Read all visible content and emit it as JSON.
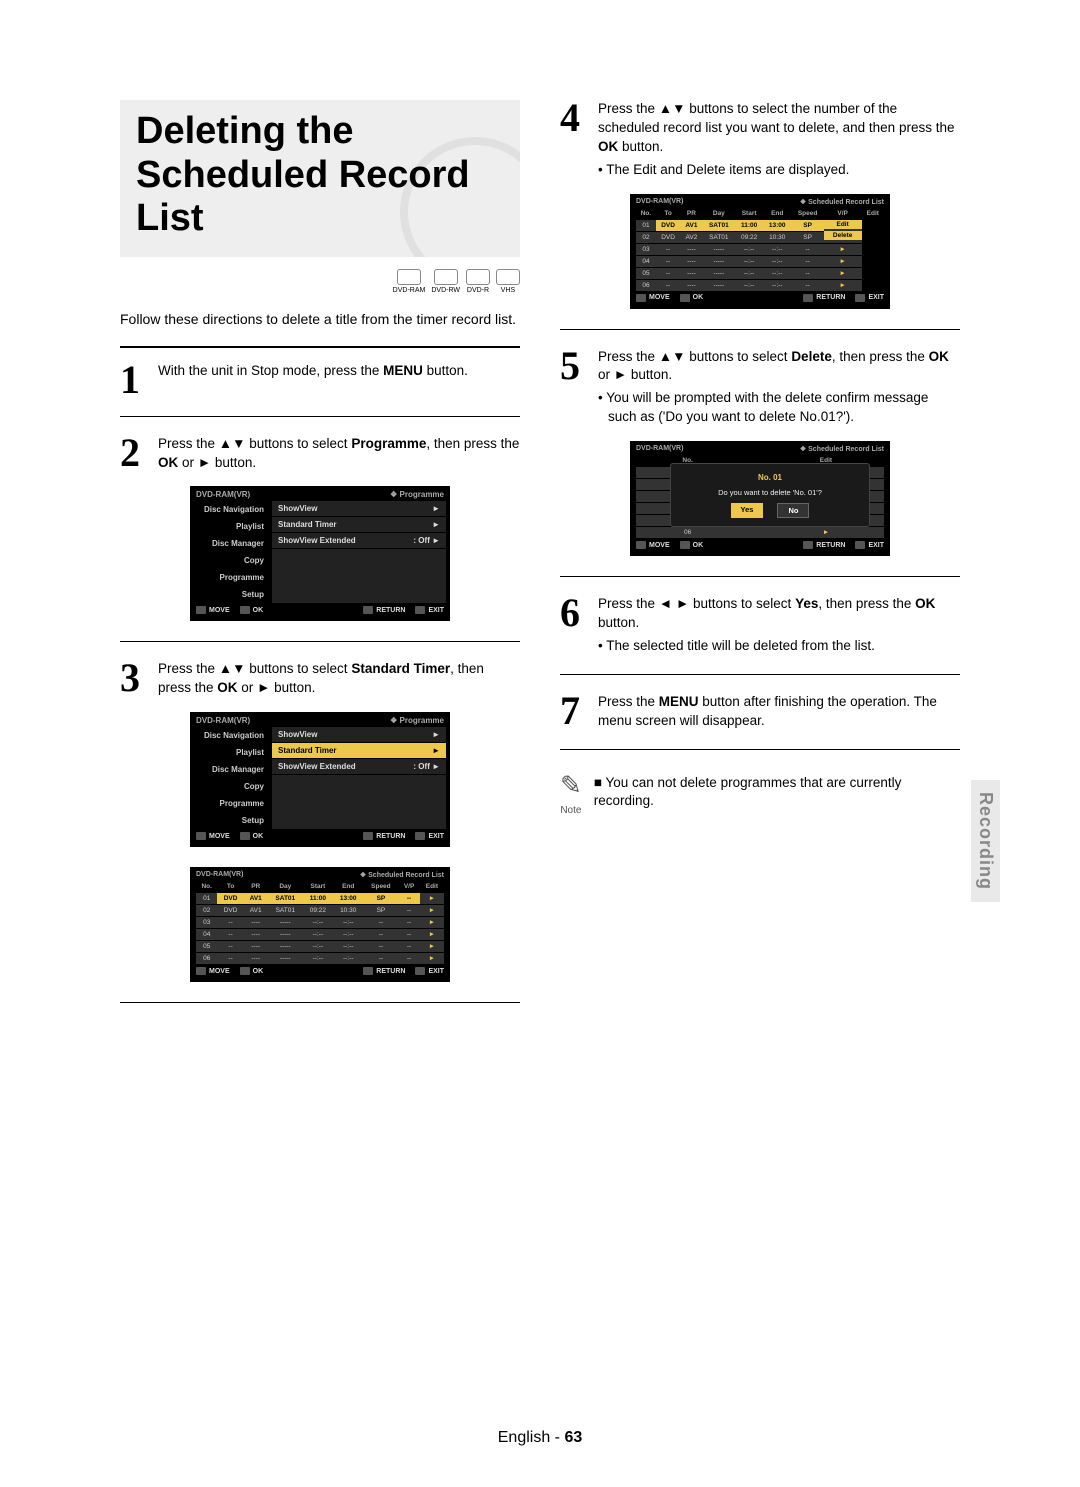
{
  "title": "Deleting the Scheduled Record List",
  "media_badges": [
    "DVD-RAM",
    "DVD-RW",
    "DVD-R",
    "VHS"
  ],
  "intro": "Follow these directions to delete a title from the timer record list.",
  "side_tab": "Recording",
  "footer": {
    "lang": "English",
    "sep": " - ",
    "page": "63"
  },
  "osd_common": {
    "device": "DVD-RAM(VR)",
    "bottom_move": "MOVE",
    "bottom_ok": "OK",
    "bottom_return": "RETURN",
    "bottom_exit": "EXIT"
  },
  "programme_menu": {
    "crumb": "Programme",
    "left": [
      "Disc Navigation",
      "Playlist",
      "Disc Manager",
      "Copy",
      "Programme",
      "Setup"
    ],
    "rows": [
      {
        "label": "ShowView",
        "val": "",
        "sel": false,
        "arrow": "►"
      },
      {
        "label": "Standard Timer",
        "val": "",
        "sel": false,
        "arrow": "►"
      },
      {
        "label": "ShowView Extended",
        "val": ": Off",
        "sel": false,
        "arrow": "►"
      }
    ]
  },
  "programme_menu_sel": {
    "crumb": "Programme",
    "rows": [
      {
        "label": "ShowView",
        "val": "",
        "sel": false,
        "arrow": "►"
      },
      {
        "label": "Standard Timer",
        "val": "",
        "sel": true,
        "arrow": "►"
      },
      {
        "label": "ShowView Extended",
        "val": ": Off",
        "sel": false,
        "arrow": "►"
      }
    ]
  },
  "sched_table": {
    "crumb": "Scheduled Record List",
    "headers": [
      "No.",
      "To",
      "PR",
      "Day",
      "Start",
      "End",
      "Speed",
      "V/P",
      "Edit"
    ],
    "rows": [
      {
        "cells": [
          "01",
          "DVD",
          "AV1",
          "SAT01",
          "11:00",
          "13:00",
          "SP",
          "--"
        ],
        "hl": true
      },
      {
        "cells": [
          "02",
          "DVD",
          "AV1",
          "SAT01",
          "09:22",
          "10:30",
          "SP",
          "--"
        ],
        "hl": false
      },
      {
        "cells": [
          "03",
          "--",
          "----",
          "-----",
          "--:--",
          "--:--",
          "--",
          "--"
        ],
        "hl": false
      },
      {
        "cells": [
          "04",
          "--",
          "----",
          "-----",
          "--:--",
          "--:--",
          "--",
          "--"
        ],
        "hl": false
      },
      {
        "cells": [
          "05",
          "--",
          "----",
          "-----",
          "--:--",
          "--:--",
          "--",
          "--"
        ],
        "hl": false
      },
      {
        "cells": [
          "06",
          "--",
          "----",
          "-----",
          "--:--",
          "--:--",
          "--",
          "--"
        ],
        "hl": false
      }
    ]
  },
  "sched_table_edit": {
    "crumb": "Scheduled Record List",
    "rows": [
      {
        "cells": [
          "01",
          "DVD",
          "AV1",
          "SAT01",
          "11:00",
          "13:00",
          "SP"
        ],
        "hl": true,
        "edit": "Edit"
      },
      {
        "cells": [
          "02",
          "DVD",
          "AV2",
          "SAT01",
          "09:22",
          "10:30",
          "SP"
        ],
        "hl": false,
        "edit": "Delete"
      },
      {
        "cells": [
          "03",
          "--",
          "----",
          "-----",
          "--:--",
          "--:--",
          "--"
        ],
        "hl": false,
        "edit": ""
      },
      {
        "cells": [
          "04",
          "--",
          "----",
          "-----",
          "--:--",
          "--:--",
          "--"
        ],
        "hl": false,
        "edit": ""
      },
      {
        "cells": [
          "05",
          "--",
          "----",
          "-----",
          "--:--",
          "--:--",
          "--"
        ],
        "hl": false,
        "edit": ""
      },
      {
        "cells": [
          "06",
          "--",
          "----",
          "-----",
          "--:--",
          "--:--",
          "--"
        ],
        "hl": false,
        "edit": ""
      }
    ]
  },
  "dialog": {
    "crumb": "Scheduled Record List",
    "no_label": "No.",
    "title": "No. 01",
    "msg": "Do you want to delete 'No. 01'?",
    "yes": "Yes",
    "no": "No",
    "edit_label": "Edit"
  },
  "steps": {
    "s1": {
      "num": "1",
      "html_parts": [
        "With the unit in Stop mode, press the ",
        "MENU",
        " button."
      ]
    },
    "s2": {
      "num": "2",
      "html_parts": [
        "Press the ▲▼ buttons to select ",
        "Programme",
        ", then press the ",
        "OK",
        " or ► button."
      ]
    },
    "s3": {
      "num": "3",
      "html_parts": [
        "Press the ▲▼ buttons to select ",
        "Standard Timer",
        ", then press the ",
        "OK",
        " or ► button."
      ]
    },
    "s4": {
      "num": "4",
      "html_parts": [
        "Press the ▲▼ buttons to select the number of the scheduled record list you want to delete, and then press the ",
        "OK",
        " button."
      ],
      "sub": "• The Edit and Delete items are displayed."
    },
    "s5": {
      "num": "5",
      "html_parts": [
        "Press the ▲▼ buttons to select ",
        "Delete",
        ", then press the ",
        "OK",
        " or ► button."
      ],
      "sub": "• You will be prompted with the delete confirm message such as ('Do you want to delete No.01?')."
    },
    "s6": {
      "num": "6",
      "html_parts": [
        "Press the ◄ ► buttons to select ",
        "Yes",
        ", then press the ",
        "OK",
        " button."
      ],
      "sub": "• The selected title will be deleted from the list."
    },
    "s7": {
      "num": "7",
      "html_parts": [
        "Press the ",
        "MENU",
        " button after finishing the operation. The menu screen will disappear."
      ]
    }
  },
  "note": {
    "icon_text": "Note",
    "text": "You can not delete programmes that are currently recording."
  }
}
